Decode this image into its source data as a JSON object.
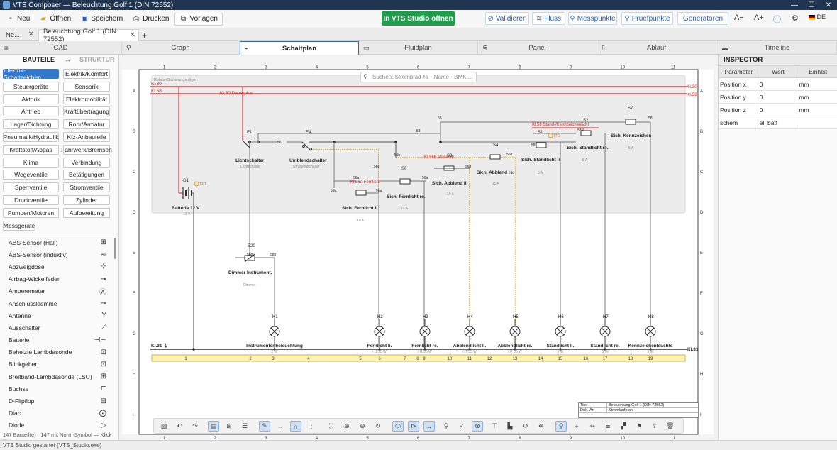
{
  "window": {
    "title": "VTS Composer — Beleuchtung Golf 1 (DIN 72552)",
    "minimize": "—",
    "maximize": "☐",
    "close": "✕"
  },
  "toolbar": {
    "new": "Neu",
    "open": "Öffnen",
    "save": "Speichern",
    "print": "Drucken",
    "templates": "Vorlagen",
    "vts_studio": "In VTS Studio öffnen",
    "validate": "Validieren",
    "flow": "Fluss",
    "measure_points": "Messpunkte",
    "test_points": "Pruefpunkte",
    "generators": "Generatoren",
    "font_smaller": "A−",
    "font_larger": "A+",
    "language": "DE"
  },
  "tabs": [
    {
      "label": "Ne..."
    },
    {
      "label": "Beleuchtung Golf 1 (DIN 72552)"
    }
  ],
  "new_tab": "+",
  "panes": {
    "cad": "CAD",
    "graph": "Graph",
    "schaltplan": "Schaltplan",
    "fluidplan": "Fluidplan",
    "panel": "Panel",
    "ablauf": "Ablauf",
    "timeline": "Timeline"
  },
  "left_panel": {
    "tab_parts": "BAUTEILE",
    "tab_arrow": "↔",
    "tab_structure": "STRUKTUR",
    "categories": [
      "Elektrik-Schaltzeichen",
      "Elektrik/Komfort",
      "Steuergeräte",
      "Sensorik",
      "Aktorik",
      "Elektromobilität",
      "Antrieb",
      "Kraftübertragung",
      "Lager/Dichtung",
      "Rohr/Armatur",
      "Pneumatik/Hydraulik",
      "Kfz-Anbauteile",
      "Kraftstoff/Abgas",
      "Fahrwerk/Bremsen",
      "Klima",
      "Verbindung",
      "Wegeventile",
      "Betätigungen",
      "Sperrventile",
      "Stromventile",
      "Druckventile",
      "Zylinder",
      "Pumpen/Motoren",
      "Aufbereitung",
      "Messgeräte"
    ],
    "components": [
      {
        "label": "ABS-Sensor (Hall)",
        "symbol": "⊞"
      },
      {
        "label": "ABS-Sensor (induktiv)",
        "symbol": "≂"
      },
      {
        "label": "Abzweigdose",
        "symbol": "⊹"
      },
      {
        "label": "Airbag-Wickelfeder",
        "symbol": "⇥"
      },
      {
        "label": "Amperemeter",
        "symbol": "Ⓐ"
      },
      {
        "label": "Anschlussklemme",
        "symbol": "⊸"
      },
      {
        "label": "Antenne",
        "symbol": "Y"
      },
      {
        "label": "Ausschalter",
        "symbol": "⟋"
      },
      {
        "label": "Batterie",
        "symbol": "⊣⊢"
      },
      {
        "label": "Beheizte Lambdasonde",
        "symbol": "⊡"
      },
      {
        "label": "Blinkgeber",
        "symbol": "⊡"
      },
      {
        "label": "Breitband-Lambdasonde (LSU)",
        "symbol": "⊞"
      },
      {
        "label": "Buchse",
        "symbol": "⊏"
      },
      {
        "label": "D-Flipflop",
        "symbol": "⊟"
      },
      {
        "label": "Diac",
        "symbol": "⨀"
      },
      {
        "label": "Diode",
        "symbol": "▷"
      }
    ],
    "footer": "147 Bauteil(e) · 147 mit Norm-Symbol — Klick fügt ein."
  },
  "search": {
    "placeholder": "Suchen: Strompfad-Nr · Name · BMK ..."
  },
  "schematic": {
    "col_numbers": [
      "1",
      "2",
      "3",
      "4",
      "5",
      "6",
      "7",
      "8",
      "9",
      "10",
      "11"
    ],
    "row_letters": [
      "A",
      "B",
      "C",
      "D",
      "E",
      "F",
      "G",
      "H",
      "I"
    ],
    "relay_carrier": "Relais-/Sicherungsträger",
    "rails": {
      "kl30": "Kl.30",
      "kl58": "Kl.58",
      "kl30_dauerplus": "Kl.30 Dauerplus",
      "kl31": "Kl.31",
      "kl31_ground": "Kl.31 ⏚",
      "kl58_stand": "Kl.58 Stand-/Kennzeichenlicht",
      "kl56_abblend": "Kl.56b Abblendl.",
      "kl56_fern": "Kl.56a Fernlicht"
    },
    "devices": {
      "g1": "-G1",
      "tp1": "TP1",
      "battery": "Batterie 12 V",
      "battery_value": "12 V",
      "e1": "E1",
      "e4": "E4",
      "e20": "E20",
      "lichtschalter": "Lichtschalter",
      "lichtschalter_sub": "Lichtschalter",
      "umblendschalter": "Umblendschalter",
      "umblendschalter_sub": "Umblendschalter",
      "dimmer": "Dimmer Instrument.",
      "dimmer_sub": "Dimmer",
      "s1": "S1",
      "s2": "S2",
      "s3": "S3",
      "s4": "S4",
      "s6": "S6",
      "s7": "S7",
      "tp2": "TP2",
      "fuse_fern_li": "Sich. Fernlicht li.",
      "fuse_fern_li_val": "10 A",
      "fuse_fern_re": "Sich. Fernlicht re.",
      "fuse_fern_re_val": "10 A",
      "fuse_abbl_li": "Sich. Abblend li.",
      "fuse_abbl_li_val": "10 A",
      "fuse_abbl_re": "Sich. Abblend re.",
      "fuse_abbl_re_val": "10 A",
      "fuse_stand_li": "Sich. Standlicht li.",
      "fuse_stand_li_val": "5 A",
      "fuse_stand_re": "Sich. Standlicht re.",
      "fuse_stand_re_val": "5 A",
      "fuse_kennz": "Sich. Kennzeichen",
      "fuse_kennz_val": "5 A",
      "term_56": "56",
      "term_56a": "56a",
      "term_56b": "56b",
      "term_58": "58",
      "term_58b": "58b",
      "term_58l": "58L",
      "term_58r": "58R"
    },
    "lamps": [
      {
        "id": "-H1",
        "label": "Instrumentenbeleuchtung",
        "value": "2 W"
      },
      {
        "id": "-H2",
        "label": "Fernlicht li.",
        "value": "H1 55 W"
      },
      {
        "id": "-H3",
        "label": "Fernlicht re.",
        "value": "H1 55 W"
      },
      {
        "id": "-H4",
        "label": "Abblendlicht li.",
        "value": "H7 55 W"
      },
      {
        "id": "-H5",
        "label": "Abblendlicht re.",
        "value": "H7 55 W"
      },
      {
        "id": "-H6",
        "label": "Standlicht li.",
        "value": "5 W"
      },
      {
        "id": "-H7",
        "label": "Standlicht re.",
        "value": "5 W"
      },
      {
        "id": "-H8",
        "label": "Kennzeichenleuchte",
        "value": "5 W"
      }
    ],
    "path_numbers": [
      "1",
      "2",
      "3",
      "4",
      "5",
      "6",
      "7",
      "8",
      "9",
      "10",
      "11",
      "12",
      "13",
      "14",
      "15",
      "16",
      "17",
      "18",
      "19"
    ],
    "colors": {
      "kl30": "#cc2222",
      "kl31": "#333333",
      "abblend": "#c89a00",
      "wire": "#7a7a7a",
      "bus": "#fff3b0"
    }
  },
  "titleblock": {
    "k1": "Titel",
    "v1": "Beleuchtung Golf 1 (DIN 72552)",
    "k2": "Dok.-Art",
    "v2": "Stromlaufplan"
  },
  "inspector": {
    "title": "INSPECTOR",
    "headers": [
      "Parameter",
      "Wert",
      "Einheit"
    ],
    "rows": [
      {
        "param": "Position x",
        "value": "0",
        "unit": "mm"
      },
      {
        "param": "Position y",
        "value": "0",
        "unit": "mm"
      },
      {
        "param": "Position z",
        "value": "0",
        "unit": "mm"
      },
      {
        "param": "schem",
        "value": "el_batt",
        "unit": ""
      }
    ]
  },
  "status": "VTS Studio gestartet (VTS_Studio.exe)"
}
